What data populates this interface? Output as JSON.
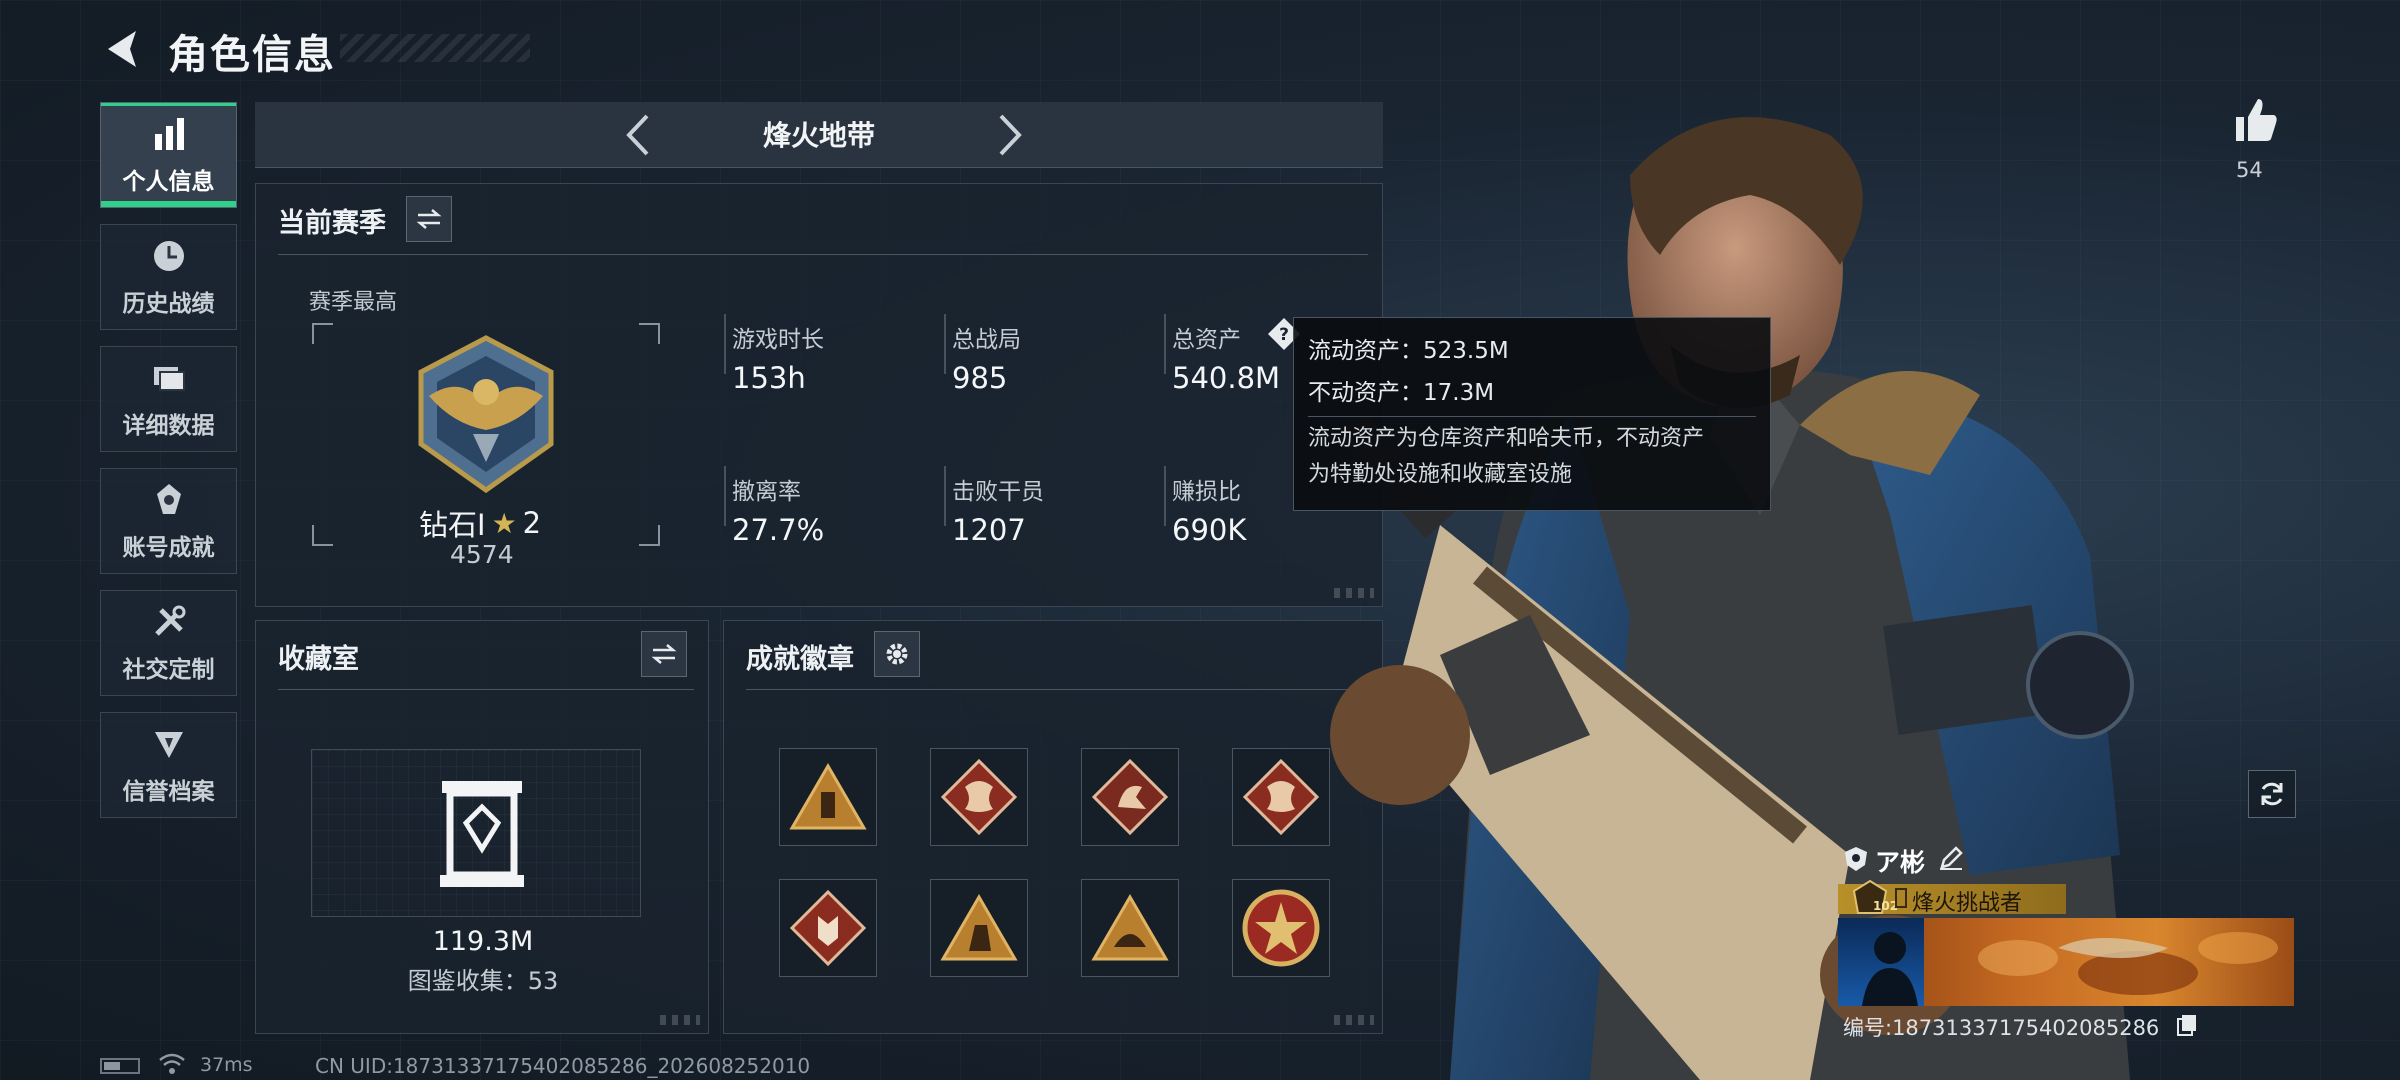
{
  "header": {
    "title": "角色信息"
  },
  "sidebar": {
    "items": [
      {
        "label": "个人信息",
        "icon": "bar-chart-icon",
        "active": true
      },
      {
        "label": "历史战绩",
        "icon": "clock-icon"
      },
      {
        "label": "详细数据",
        "icon": "folder-icon"
      },
      {
        "label": "账号成就",
        "icon": "achievement-icon"
      },
      {
        "label": "社交定制",
        "icon": "wrench-icon"
      },
      {
        "label": "信誉档案",
        "icon": "credibility-icon"
      }
    ]
  },
  "mode": {
    "title": "烽火地带"
  },
  "season": {
    "title": "当前赛季",
    "best_label": "赛季最高",
    "rank_name": "钻石I",
    "rank_stars": "2",
    "rank_score": "4574",
    "stats": [
      {
        "label": "游戏时长",
        "value": "153h"
      },
      {
        "label": "总战局",
        "value": "985"
      },
      {
        "label": "总资产",
        "value": "540.8M"
      },
      {
        "label": "撤离率",
        "value": "27.7%"
      },
      {
        "label": "击败干员",
        "value": "1207"
      },
      {
        "label": "赚损比",
        "value": "690K"
      }
    ]
  },
  "tooltip": {
    "liquid": "流动资产：523.5M",
    "fixed": "不动资产：17.3M",
    "desc_1": "流动资产为仓库资产和哈夫币，不动资产",
    "desc_2": "为特勤处设施和收藏室设施"
  },
  "collection": {
    "title": "收藏室",
    "value": "119.3M",
    "catalog": "图鉴收集：53"
  },
  "badges": {
    "title": "成就徽章"
  },
  "likes": {
    "count": "54"
  },
  "player": {
    "name": "ア彬",
    "level": "102",
    "title": "烽火挑战者",
    "id": "编号:18731337175402085286"
  },
  "status_bar": {
    "ping": "37ms",
    "uid": "CN UID:18731337175402085286_202608252010"
  },
  "colors": {
    "accent": "#2fd08a",
    "gold": "#b8902a",
    "panel": "#1a232e"
  }
}
